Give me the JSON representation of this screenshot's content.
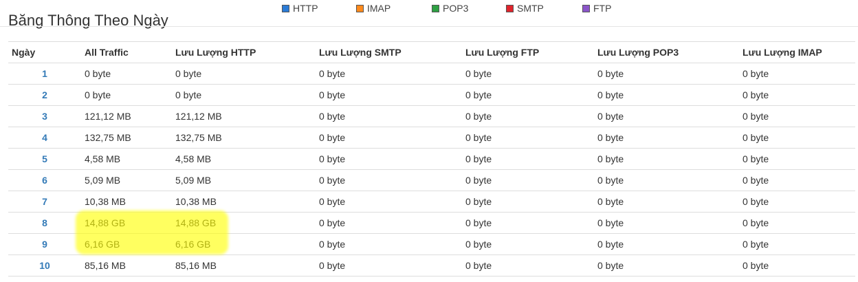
{
  "page": {
    "title": "Băng Thông Theo Ngày"
  },
  "legend": [
    {
      "label": "HTTP",
      "color": "#2b7bd6"
    },
    {
      "label": "IMAP",
      "color": "#ff8a1c"
    },
    {
      "label": "POP3",
      "color": "#2ea043"
    },
    {
      "label": "SMTP",
      "color": "#e0242c"
    },
    {
      "label": "FTP",
      "color": "#8b55c9"
    }
  ],
  "table": {
    "headers": [
      "Ngày",
      "All Traffic",
      "Lưu Lượng HTTP",
      "Lưu Lượng SMTP",
      "Lưu Lượng FTP",
      "Lưu Lượng POP3",
      "Lưu Lượng IMAP"
    ],
    "rows": [
      [
        "1",
        "0 byte",
        "0 byte",
        "0 byte",
        "0 byte",
        "0 byte",
        "0 byte"
      ],
      [
        "2",
        "0 byte",
        "0 byte",
        "0 byte",
        "0 byte",
        "0 byte",
        "0 byte"
      ],
      [
        "3",
        "121,12 MB",
        "121,12 MB",
        "0 byte",
        "0 byte",
        "0 byte",
        "0 byte"
      ],
      [
        "4",
        "132,75 MB",
        "132,75 MB",
        "0 byte",
        "0 byte",
        "0 byte",
        "0 byte"
      ],
      [
        "5",
        "4,58 MB",
        "4,58 MB",
        "0 byte",
        "0 byte",
        "0 byte",
        "0 byte"
      ],
      [
        "6",
        "5,09 MB",
        "5,09 MB",
        "0 byte",
        "0 byte",
        "0 byte",
        "0 byte"
      ],
      [
        "7",
        "10,38 MB",
        "10,38 MB",
        "0 byte",
        "0 byte",
        "0 byte",
        "0 byte"
      ],
      [
        "8",
        "14,88 GB",
        "14,88 GB",
        "0 byte",
        "0 byte",
        "0 byte",
        "0 byte"
      ],
      [
        "9",
        "6,16 GB",
        "6,16 GB",
        "0 byte",
        "0 byte",
        "0 byte",
        "0 byte"
      ],
      [
        "10",
        "85,16 MB",
        "85,16 MB",
        "0 byte",
        "0 byte",
        "0 byte",
        "0 byte"
      ]
    ]
  },
  "highlight": {
    "color": "#ffff00",
    "rows": [
      "8",
      "9"
    ]
  }
}
